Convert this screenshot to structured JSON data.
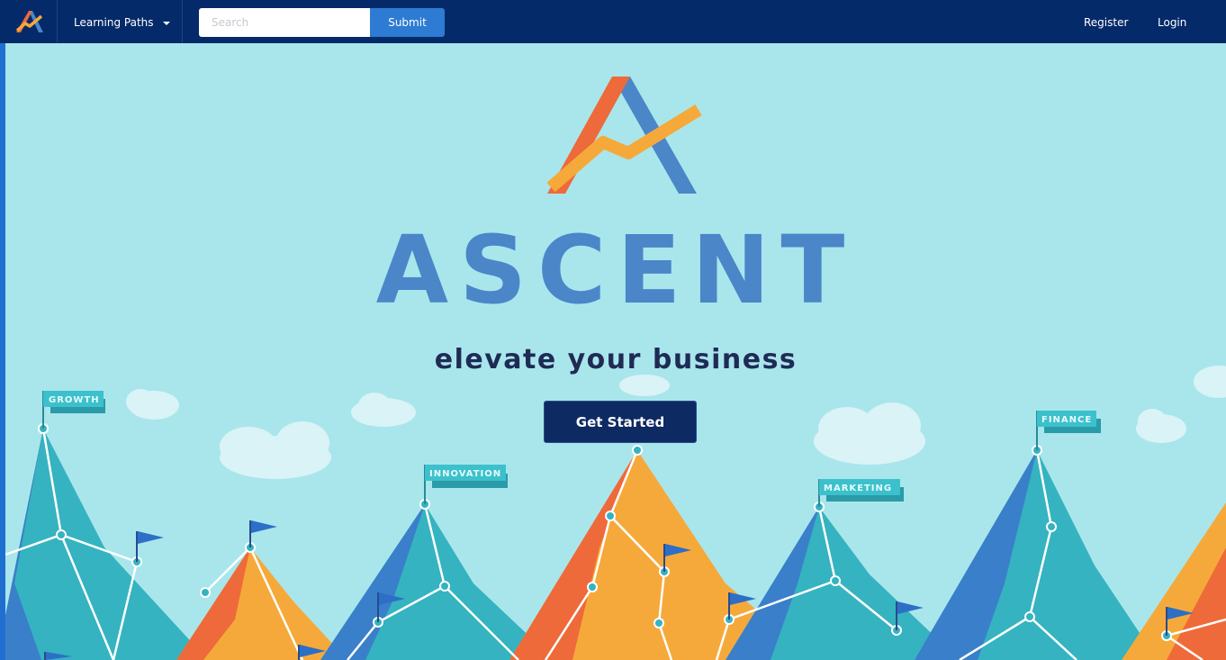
{
  "navbar": {
    "learning_paths_label": "Learning Paths",
    "search_placeholder": "Search",
    "submit_label": "Submit",
    "register_label": "Register",
    "login_label": "Login"
  },
  "hero": {
    "title": "ASCENT",
    "tagline": "elevate your business",
    "cta_label": "Get Started",
    "peak_flags": {
      "growth": "GROWTH",
      "innovation": "INNOVATION",
      "marketing": "MARKETING",
      "finance": "FINANCE"
    }
  },
  "colors": {
    "nav_background": "#052a6a",
    "hero_background": "#a9e6ec",
    "brand_blue": "#4a86c8",
    "cta_background": "#0e2a62",
    "submit_background": "#2d7bd2",
    "mountain_teal": "#35b3c0",
    "mountain_orange": "#f6a93b",
    "mountain_red": "#ee6a3a"
  }
}
